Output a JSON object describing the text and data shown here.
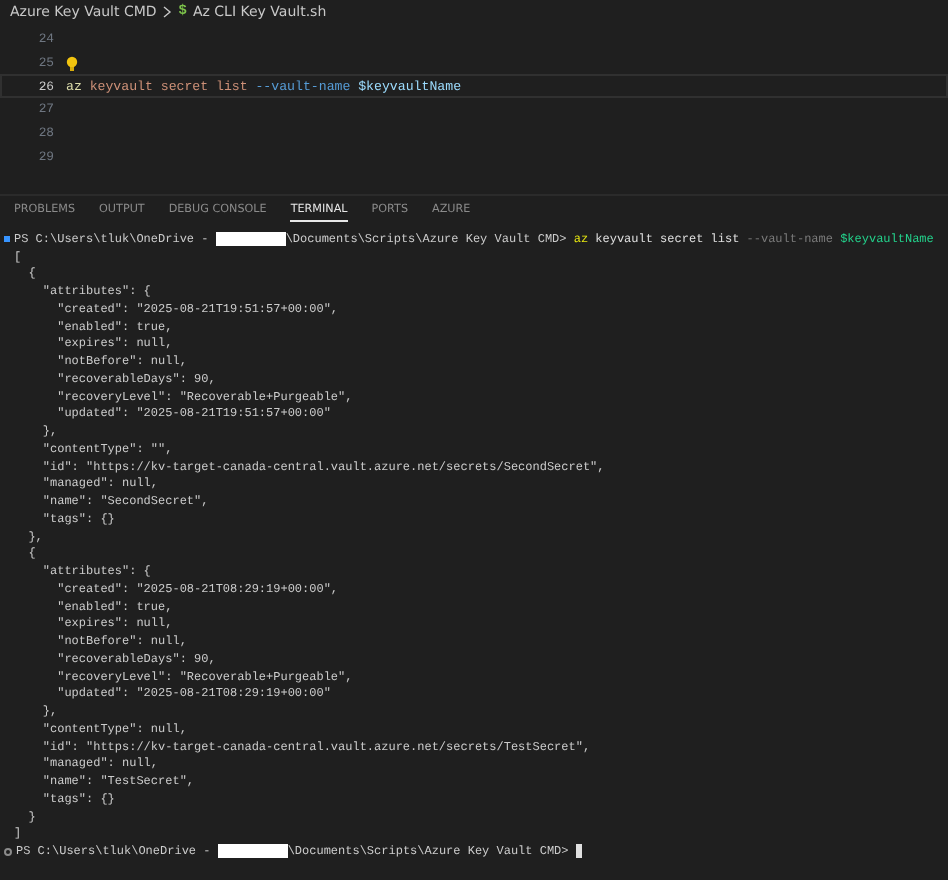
{
  "breadcrumb": [
    {
      "label": "Azure Key Vault CMD"
    },
    {
      "label": "Az CLI Key Vault.sh",
      "icon": "$"
    }
  ],
  "editor": {
    "lines": [
      {
        "number": "24",
        "current": false,
        "lightbulb": false
      },
      {
        "number": "25",
        "current": false,
        "lightbulb": true
      },
      {
        "number": "26",
        "current": true,
        "lightbulb": false,
        "tokens": [
          {
            "kind": "command",
            "text": "az"
          },
          {
            "kind": "word",
            "text": "keyvault"
          },
          {
            "kind": "word",
            "text": "secret"
          },
          {
            "kind": "word",
            "text": "list"
          },
          {
            "kind": "option",
            "text": "--vault-name"
          },
          {
            "kind": "variable",
            "text": "$keyvaultName"
          }
        ]
      },
      {
        "number": "27",
        "current": false,
        "lightbulb": false
      },
      {
        "number": "28",
        "current": false,
        "lightbulb": false
      },
      {
        "number": "29",
        "current": false,
        "lightbulb": false
      }
    ]
  },
  "panel_tabs": [
    {
      "label": "PROBLEMS",
      "selected": false
    },
    {
      "label": "OUTPUT",
      "selected": false
    },
    {
      "label": "DEBUG CONSOLE",
      "selected": false
    },
    {
      "label": "TERMINAL",
      "selected": true
    },
    {
      "label": "PORTS",
      "selected": false
    },
    {
      "label": "AZURE",
      "selected": false
    }
  ],
  "terminal": [
    {
      "kind": "prompt",
      "succeeded": true,
      "before": "PS C:\\Users\\tluk\\OneDrive - ",
      "redacted": true,
      "after": "\\Documents\\Scripts\\Azure Key Vault CMD>",
      "cursor": false,
      "tokens": [
        {
          "kind": "command",
          "text": "az"
        },
        {
          "kind": "word",
          "text": "keyvault secret list"
        },
        {
          "kind": "option",
          "text": "--vault-name"
        },
        {
          "kind": "variable",
          "text": "$keyvaultName"
        }
      ]
    },
    {
      "kind": "output",
      "text": "["
    },
    {
      "kind": "output",
      "text": "  {"
    },
    {
      "kind": "output",
      "text": "    \"attributes\": {"
    },
    {
      "kind": "output",
      "text": "      \"created\": \"2025-08-21T19:51:57+00:00\","
    },
    {
      "kind": "output",
      "text": "      \"enabled\": true,"
    },
    {
      "kind": "output",
      "text": "      \"expires\": null,"
    },
    {
      "kind": "output",
      "text": "      \"notBefore\": null,"
    },
    {
      "kind": "output",
      "text": "      \"recoverableDays\": 90,"
    },
    {
      "kind": "output",
      "text": "      \"recoveryLevel\": \"Recoverable+Purgeable\","
    },
    {
      "kind": "output",
      "text": "      \"updated\": \"2025-08-21T19:51:57+00:00\""
    },
    {
      "kind": "output",
      "text": "    },"
    },
    {
      "kind": "output",
      "text": "    \"contentType\": \"\","
    },
    {
      "kind": "output",
      "text": "    \"id\": \"https://kv-target-canada-central.vault.azure.net/secrets/SecondSecret\","
    },
    {
      "kind": "output",
      "text": "    \"managed\": null,"
    },
    {
      "kind": "output",
      "text": "    \"name\": \"SecondSecret\","
    },
    {
      "kind": "output",
      "text": "    \"tags\": {}"
    },
    {
      "kind": "output",
      "text": "  },"
    },
    {
      "kind": "output",
      "text": "  {"
    },
    {
      "kind": "output",
      "text": "    \"attributes\": {"
    },
    {
      "kind": "output",
      "text": "      \"created\": \"2025-08-21T08:29:19+00:00\","
    },
    {
      "kind": "output",
      "text": "      \"enabled\": true,"
    },
    {
      "kind": "output",
      "text": "      \"expires\": null,"
    },
    {
      "kind": "output",
      "text": "      \"notBefore\": null,"
    },
    {
      "kind": "output",
      "text": "      \"recoverableDays\": 90,"
    },
    {
      "kind": "output",
      "text": "      \"recoveryLevel\": \"Recoverable+Purgeable\","
    },
    {
      "kind": "output",
      "text": "      \"updated\": \"2025-08-21T08:29:19+00:00\""
    },
    {
      "kind": "output",
      "text": "    },"
    },
    {
      "kind": "output",
      "text": "    \"contentType\": null,"
    },
    {
      "kind": "output",
      "text": "    \"id\": \"https://kv-target-canada-central.vault.azure.net/secrets/TestSecret\","
    },
    {
      "kind": "output",
      "text": "    \"managed\": null,"
    },
    {
      "kind": "output",
      "text": "    \"name\": \"TestSecret\","
    },
    {
      "kind": "output",
      "text": "    \"tags\": {}"
    },
    {
      "kind": "output",
      "text": "  }"
    },
    {
      "kind": "output",
      "text": "]"
    },
    {
      "kind": "prompt",
      "succeeded": false,
      "before": "PS C:\\Users\\tluk\\OneDrive - ",
      "redacted": true,
      "after": "\\Documents\\Scripts\\Azure Key Vault CMD>",
      "cursor": true
    }
  ]
}
